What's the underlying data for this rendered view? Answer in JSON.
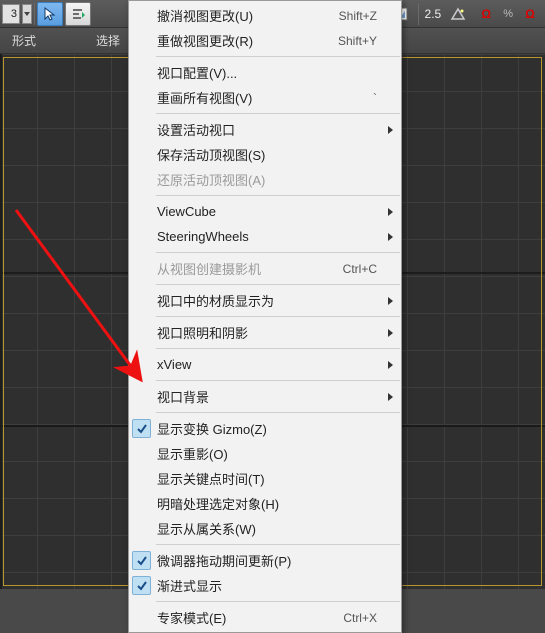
{
  "toolbar": {
    "field_value": "3",
    "zoom": "2.5",
    "percent": "%"
  },
  "row2": {
    "label1": "形式",
    "label2": "选择"
  },
  "menu": {
    "undo": "撤消视图更改(U)",
    "undo_sc": "Shift+Z",
    "redo": "重做视图更改(R)",
    "redo_sc": "Shift+Y",
    "vp_config": "视口配置(V)...",
    "redraw": "重画所有视图(V)",
    "redraw_sc": "`",
    "set_active": "设置活动视口",
    "save_top": "保存活动顶视图(S)",
    "restore_top": "还原活动顶视图(A)",
    "viewcube": "ViewCube",
    "wheels": "SteeringWheels",
    "create_cam": "从视图创建摄影机",
    "create_cam_sc": "Ctrl+C",
    "mat_display": "视口中的材质显示为",
    "light_shadow": "视口照明和阴影",
    "xview": "xView",
    "vp_bg": "视口背景",
    "show_gizmo": "显示变换 Gizmo(Z)",
    "show_ghost": "显示重影(O)",
    "show_keytime": "显示关键点时间(T)",
    "shade_sel": "明暗处理选定对象(H)",
    "show_dep": "显示从属关系(W)",
    "update_drag": "微调器拖动期间更新(P)",
    "progressive": "渐进式显示",
    "expert": "专家模式(E)",
    "expert_sc": "Ctrl+X"
  }
}
